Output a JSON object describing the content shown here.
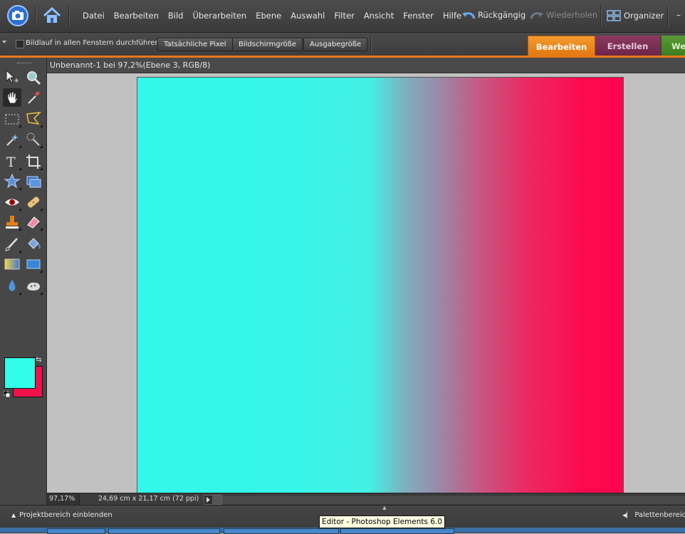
{
  "menubar": {
    "items": [
      "Datei",
      "Bearbeiten",
      "Bild",
      "Überarbeiten",
      "Ebene",
      "Auswahl",
      "Filter",
      "Ansicht",
      "Fenster",
      "Hilfe"
    ],
    "undo_label": "Rückgängig",
    "redo_label": "Wiederholen",
    "organizer_label": "Organizer"
  },
  "options": {
    "scroll_all_label": "Bildlauf in allen Fenstern durchführen",
    "actual_pixels_label": "Tatsächliche Pixel",
    "fit_screen_label": "Bildschirmgröße",
    "print_size_label": "Ausgabegröße"
  },
  "tabs": {
    "edit": "Bearbeiten",
    "create": "Erstellen",
    "share": "Wei"
  },
  "document": {
    "title": "Unbenannt-1 bei 97,2%(Ebene 3, RGB/8)"
  },
  "colors": {
    "foreground": "#32fde8",
    "background": "#f0114b",
    "gradient_start": "#33f7e9",
    "gradient_end": "#ff0550",
    "accent": "#e87a1a"
  },
  "status": {
    "zoom": "97,17%",
    "doc_info": "24,69 cm x 21,17 cm (72 ppi)"
  },
  "bottom": {
    "project_bin_label": "Projektbereich einblenden",
    "palette_bin_label": "Palettenbereich"
  },
  "tooltip": {
    "text": "Editor - Photoshop Elements 6.0"
  }
}
